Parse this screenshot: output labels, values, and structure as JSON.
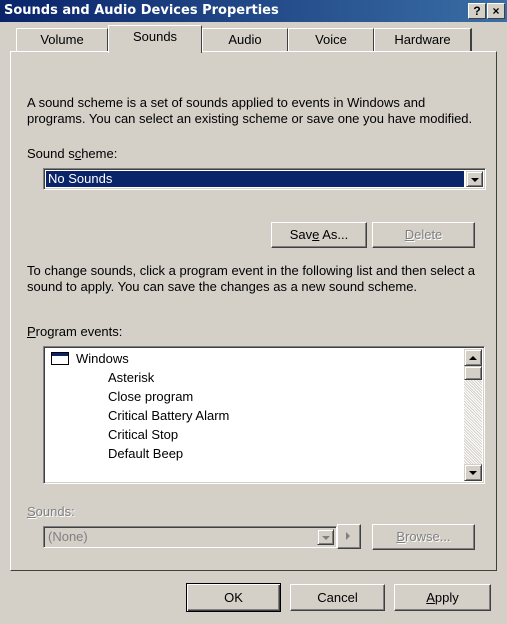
{
  "window": {
    "title": "Sounds and Audio Devices Properties",
    "help_label": "?",
    "close_label": "×"
  },
  "tabs": [
    {
      "label": "Volume"
    },
    {
      "label": "Sounds"
    },
    {
      "label": "Audio"
    },
    {
      "label": "Voice"
    },
    {
      "label": "Hardware"
    }
  ],
  "scheme": {
    "description": "A sound scheme is a set of sounds applied to events in Windows and programs. You can select an existing scheme or save one you have modified.",
    "label_pre": "Sound s",
    "label_key": "c",
    "label_post": "heme:",
    "selected": "No Sounds",
    "save_pre": "Sav",
    "save_key": "e",
    "save_post": " As...",
    "delete_key": "D",
    "delete_post": "elete"
  },
  "events": {
    "description": "To change sounds, click a program event in the following list and then select a sound to apply. You can save the changes as a new sound scheme.",
    "label_key": "P",
    "label_post": "rogram events:",
    "group": "Windows",
    "items": [
      "Asterisk",
      "Close program",
      "Critical Battery Alarm",
      "Critical Stop",
      "Default Beep"
    ]
  },
  "sounds": {
    "label_key": "S",
    "label_post": "ounds:",
    "value": "(None)",
    "browse_key": "B",
    "browse_post": "rowse..."
  },
  "footer": {
    "ok_label": "OK",
    "cancel_label": "Cancel",
    "apply_key": "A",
    "apply_post": "pply"
  }
}
